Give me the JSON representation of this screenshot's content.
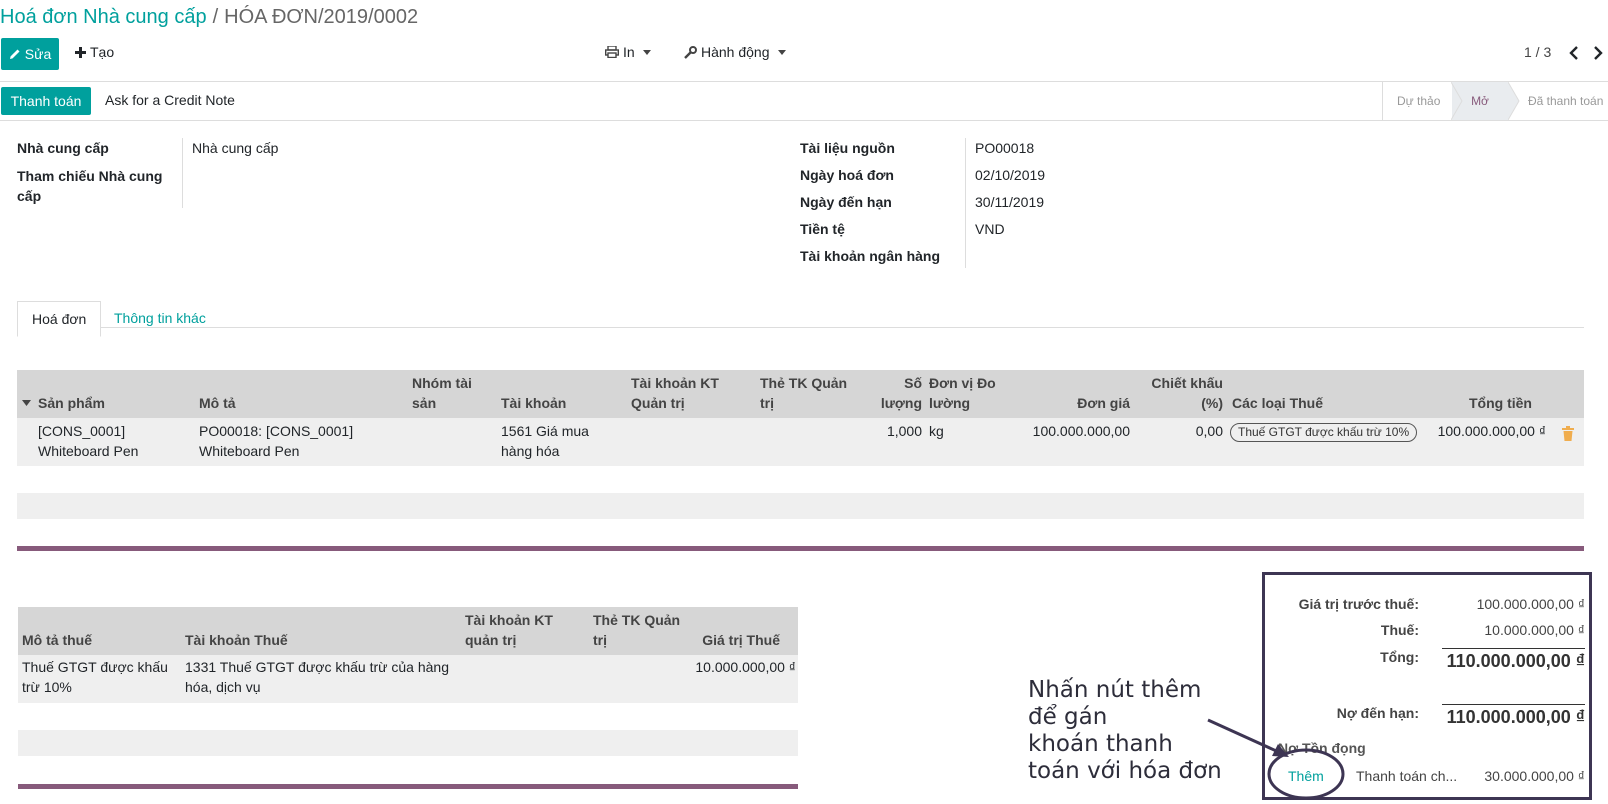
{
  "breadcrumb": {
    "parent": "Hoá đơn Nhà cung cấp",
    "separator": "/",
    "current": "HÓA ĐƠN/2019/0002"
  },
  "toolbar": {
    "edit_label": "Sửa",
    "create_label": "Tạo",
    "print_label": "In",
    "action_label": "Hành động",
    "pager": "1 / 3"
  },
  "statusbar": {
    "pay_label": "Thanh toán",
    "credit_note_label": "Ask for a Credit Note",
    "stages": [
      "Dự thảo",
      "Mở",
      "Đã thanh toán"
    ],
    "active_stage": "Mở"
  },
  "form": {
    "left": [
      {
        "label": "Nhà cung cấp",
        "value": "Nhà cung cấp"
      },
      {
        "label": "Tham chiếu Nhà cung cấp",
        "value": ""
      }
    ],
    "right": [
      {
        "label": "Tài liệu nguồn",
        "value": "PO00018"
      },
      {
        "label": "Ngày hoá đơn",
        "value": "02/10/2019"
      },
      {
        "label": "Ngày đến hạn",
        "value": "30/11/2019"
      },
      {
        "label": "Tiền tệ",
        "value": "VND"
      },
      {
        "label": "Tài khoản ngân hàng",
        "value": ""
      }
    ]
  },
  "tabs": [
    {
      "label": "Hoá đơn"
    },
    {
      "label": "Thông tin khác"
    }
  ],
  "lines_table": {
    "headers": {
      "product": "Sản phẩm",
      "description": "Mô tả",
      "asset_group": "Nhóm tài sản",
      "account": "Tài khoản",
      "analytic_account": "Tài khoản KT Quản trị",
      "analytic_tag": "Thẻ TK Quản trị",
      "quantity": "Số lượng",
      "uom": "Đơn vị Đo lường",
      "unit_price": "Đơn giá",
      "discount": "Chiết khấu (%)",
      "taxes": "Các loại Thuế",
      "subtotal": "Tổng tiền"
    },
    "rows": [
      {
        "product": "[CONS_0001] Whiteboard Pen",
        "description": "PO00018: [CONS_0001] Whiteboard Pen",
        "account": "1561 Giá mua hàng hóa",
        "quantity": "1,000",
        "uom": "kg",
        "unit_price": "100.000.000,00",
        "discount": "0,00",
        "tax": "Thuế GTGT được khấu trừ 10%",
        "subtotal": "100.000.000,00 ₫"
      }
    ]
  },
  "tax_table": {
    "headers": {
      "description": "Mô tả thuế",
      "account": "Tài khoản Thuế",
      "analytic_account": "Tài khoản KT quản trị",
      "analytic_tag": "Thẻ TK Quản trị",
      "amount": "Giá trị Thuế"
    },
    "rows": [
      {
        "description": "Thuế GTGT được khấu trừ 10%",
        "account": "1331 Thuế GTGT được khấu trừ của hàng hóa, dịch vụ",
        "amount": "10.000.000,00 ₫"
      }
    ]
  },
  "totals": {
    "untaxed_label": "Giá trị trước thuế:",
    "untaxed": "100.000.000,00 ₫",
    "tax_label": "Thuế:",
    "tax": "10.000.000,00 ₫",
    "total_label": "Tổng:",
    "total": "110.000.000,00 ₫",
    "residual_label": "Nợ đến hạn:",
    "residual": "110.000.000,00 ₫",
    "outstanding_label": "Nợ Tồn đọng",
    "add_label": "Thêm",
    "outstanding_desc": "Thanh toán ch...",
    "outstanding_amount": "30.000.000,00 ₫"
  },
  "annotation": "Nhấn nút thêm\nđể gán\nkhoán thanh\ntoán với hóa đơn",
  "colors": {
    "primary": "#00A09D",
    "accent": "#875A7B",
    "annotation": "#3d3553"
  }
}
